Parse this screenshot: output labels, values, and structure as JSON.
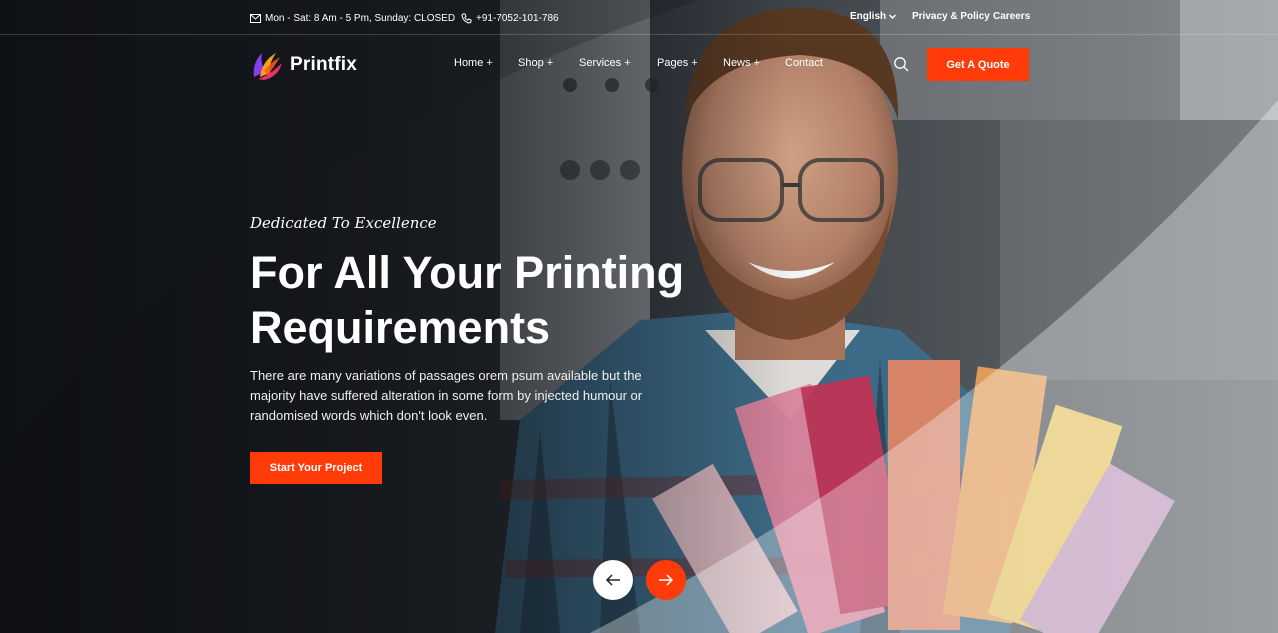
{
  "topbar": {
    "hours": "Mon - Sat: 8 Am - 5 Pm, Sunday: CLOSED",
    "phone": "+91-7052-101-786",
    "language": "English",
    "privacy": "Privacy & Policy",
    "careers": "Careers"
  },
  "brand": {
    "name": "Printfix"
  },
  "nav": {
    "items": [
      "Home +",
      "Shop +",
      "Services +",
      "Pages +",
      "News +",
      "Contact"
    ],
    "quote_button": "Get A Quote"
  },
  "hero": {
    "tagline": "Dedicated To Excellence",
    "headline_line1": "For All Your Printing",
    "headline_line2": "Requirements",
    "description": "There are many variations of passages orem psum available but the majority have suffered alteration in some form by injected humour or randomised words which don't look even.",
    "cta": "Start Your Project"
  },
  "colors": {
    "accent": "#ff3b0a",
    "text": "#ffffff"
  },
  "icons": {
    "hours": "envelope-icon",
    "phone": "phone-icon",
    "search": "search-icon",
    "prev": "arrow-left-icon",
    "next": "arrow-right-icon"
  }
}
